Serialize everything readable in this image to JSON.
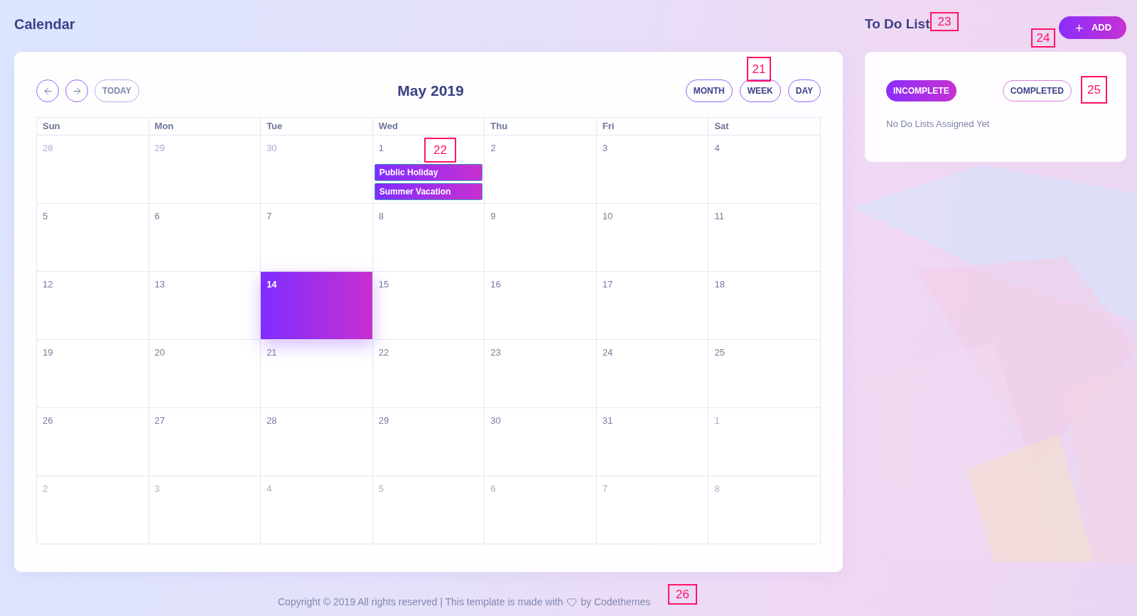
{
  "page_title": "Calendar",
  "calendar": {
    "today_button": "TODAY",
    "title": "May 2019",
    "views": [
      "MONTH",
      "WEEK",
      "DAY"
    ],
    "weekdays": [
      "Sun",
      "Mon",
      "Tue",
      "Wed",
      "Thu",
      "Fri",
      "Sat"
    ],
    "weeks": [
      [
        {
          "day": "28",
          "outside": true,
          "today": false
        },
        {
          "day": "29",
          "outside": true,
          "today": false
        },
        {
          "day": "30",
          "outside": true,
          "today": false
        },
        {
          "day": "1",
          "outside": false,
          "today": false,
          "events": [
            "Public Holiday",
            "Summer Vacation"
          ]
        },
        {
          "day": "2",
          "outside": false,
          "today": false
        },
        {
          "day": "3",
          "outside": false,
          "today": false
        },
        {
          "day": "4",
          "outside": false,
          "today": false
        }
      ],
      [
        {
          "day": "5",
          "outside": false,
          "today": false
        },
        {
          "day": "6",
          "outside": false,
          "today": false
        },
        {
          "day": "7",
          "outside": false,
          "today": false
        },
        {
          "day": "8",
          "outside": false,
          "today": false
        },
        {
          "day": "9",
          "outside": false,
          "today": false
        },
        {
          "day": "10",
          "outside": false,
          "today": false
        },
        {
          "day": "11",
          "outside": false,
          "today": false
        }
      ],
      [
        {
          "day": "12",
          "outside": false,
          "today": false
        },
        {
          "day": "13",
          "outside": false,
          "today": false
        },
        {
          "day": "14",
          "outside": false,
          "today": true
        },
        {
          "day": "15",
          "outside": false,
          "today": false
        },
        {
          "day": "16",
          "outside": false,
          "today": false
        },
        {
          "day": "17",
          "outside": false,
          "today": false
        },
        {
          "day": "18",
          "outside": false,
          "today": false
        }
      ],
      [
        {
          "day": "19",
          "outside": false,
          "today": false
        },
        {
          "day": "20",
          "outside": false,
          "today": false
        },
        {
          "day": "21",
          "outside": false,
          "today": false
        },
        {
          "day": "22",
          "outside": false,
          "today": false
        },
        {
          "day": "23",
          "outside": false,
          "today": false
        },
        {
          "day": "24",
          "outside": false,
          "today": false
        },
        {
          "day": "25",
          "outside": false,
          "today": false
        }
      ],
      [
        {
          "day": "26",
          "outside": false,
          "today": false
        },
        {
          "day": "27",
          "outside": false,
          "today": false
        },
        {
          "day": "28",
          "outside": false,
          "today": false
        },
        {
          "day": "29",
          "outside": false,
          "today": false
        },
        {
          "day": "30",
          "outside": false,
          "today": false
        },
        {
          "day": "31",
          "outside": false,
          "today": false
        },
        {
          "day": "1",
          "outside": true,
          "today": false
        }
      ],
      [
        {
          "day": "2",
          "outside": true,
          "today": false
        },
        {
          "day": "3",
          "outside": true,
          "today": false
        },
        {
          "day": "4",
          "outside": true,
          "today": false
        },
        {
          "day": "5",
          "outside": true,
          "today": false
        },
        {
          "day": "6",
          "outside": true,
          "today": false
        },
        {
          "day": "7",
          "outside": true,
          "today": false
        },
        {
          "day": "8",
          "outside": true,
          "today": false
        }
      ]
    ]
  },
  "todo": {
    "title": "To Do List",
    "add_button": "ADD",
    "tabs": [
      {
        "label": "INCOMPLETE",
        "selected": true
      },
      {
        "label": "COMPLETED",
        "selected": false
      }
    ],
    "empty_message": "No Do Lists Assigned Yet"
  },
  "footer": {
    "text_before": "Copyright © 2019 All rights reserved | This template is made with",
    "text_after": "by Codethemes"
  },
  "annotation_markers": [
    "21",
    "22",
    "23",
    "24",
    "25",
    "26"
  ]
}
